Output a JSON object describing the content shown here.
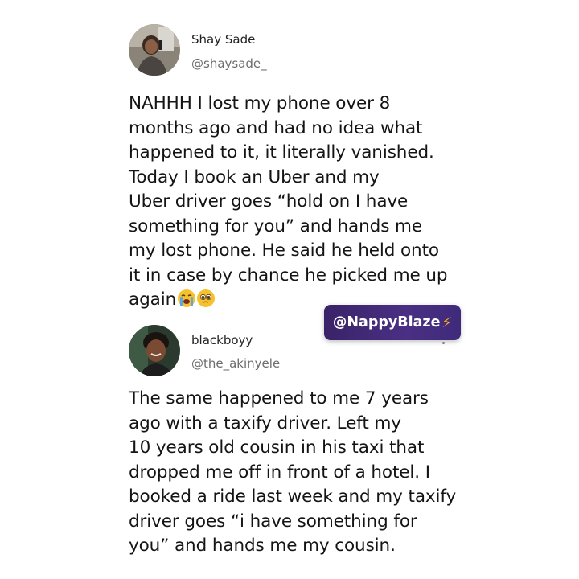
{
  "posts": [
    {
      "name": "Shay Sade",
      "handle": "@shaysade_",
      "text": "NAHHH I lost my phone over 8\nmonths ago and had no idea what\nhappened to it, it literally vanished.\nToday I book an Uber and my\nUber driver goes “hold on I have\nsomething for you” and hands me\nmy lost phone. He said he held onto\nit in case by chance he picked me up\nagain",
      "emojis": [
        "loudly-crying-face",
        "pleading-face"
      ]
    },
    {
      "name": "blackboyy",
      "handle": "@the_akinyele",
      "text": "The same happened to me 7 years\nago with a taxify driver. Left my\n10 years old cousin in his taxi that\ndropped me off in front of a hotel. I\nbooked a ride last week and my taxify\ndriver goes “i have something for\nyou” and hands me my cousin."
    }
  ],
  "watermark": {
    "label": "@NappyBlaze",
    "icon": "lightning-bolt-icon"
  },
  "colors": {
    "watermark_bg": "#3f2a7a",
    "bolt": "#ffb21a",
    "handle": "#6d6d6d"
  }
}
